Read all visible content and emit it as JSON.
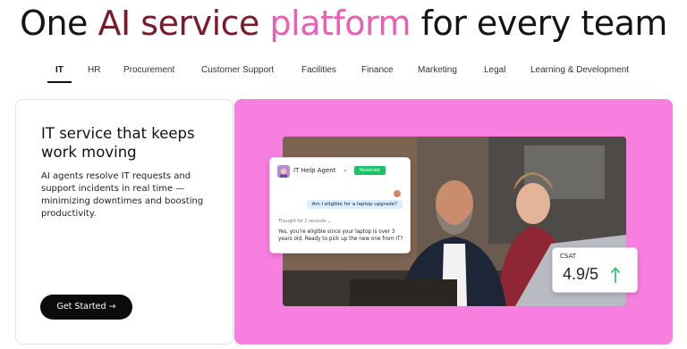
{
  "hero": {
    "title_part1": "One ",
    "title_part2": "AI service",
    "title_part3": " ",
    "title_part4": "platform",
    "title_part5": " for every team",
    "accent_dark": "#7a1a2a",
    "accent_pink": "#e85fb4"
  },
  "tabs": [
    {
      "label": "IT",
      "active": true
    },
    {
      "label": "HR"
    },
    {
      "label": "Procurement"
    },
    {
      "label": "Customer Support"
    },
    {
      "label": "Facilities"
    },
    {
      "label": "Finance"
    },
    {
      "label": "Marketing"
    },
    {
      "label": "Legal"
    },
    {
      "label": "Learning & Development"
    }
  ],
  "card": {
    "heading": "IT service that keeps work moving",
    "body": "AI agents resolve IT requests and support incidents in real time — minimizing downtimes and boosting productivity.",
    "cta_label": "Get Started",
    "cta_arrow": "→"
  },
  "panel": {
    "background": "#f77fe0"
  },
  "chat": {
    "agent_name": "IT Help Agent",
    "caret": "⌄",
    "status": "Resolved",
    "user_message": "Am I eligible for a laptop upgrade?",
    "thought": "Thought for 2 seconds",
    "thought_caret": "⌄",
    "reply": "Yes, you’re eligible since your laptop is over 3 years old. Ready to pick up the new one from IT?"
  },
  "csat": {
    "label": "CSAT",
    "value": "4.9/5",
    "arrow_color": "#21c26b"
  }
}
